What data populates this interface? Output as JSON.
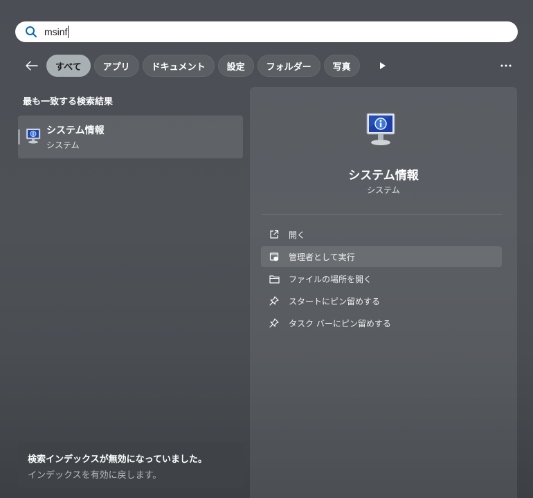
{
  "search": {
    "query": "msinf"
  },
  "filters": {
    "tabs": [
      {
        "label": "すべて",
        "active": true
      },
      {
        "label": "アプリ"
      },
      {
        "label": "ドキュメント"
      },
      {
        "label": "設定"
      },
      {
        "label": "フォルダー"
      },
      {
        "label": "写真"
      }
    ]
  },
  "results": {
    "section_title": "最も一致する検索結果",
    "best_match": {
      "name": "システム情報",
      "type": "システム",
      "icon": "system-info-monitor-icon"
    }
  },
  "detail": {
    "name": "システム情報",
    "type": "システム",
    "actions": [
      {
        "label": "開く",
        "icon": "open-external-icon"
      },
      {
        "label": "管理者として実行",
        "icon": "admin-shield-icon"
      },
      {
        "label": "ファイルの場所を開く",
        "icon": "folder-icon"
      },
      {
        "label": "スタートにピン留めする",
        "icon": "pin-icon"
      },
      {
        "label": "タスク バーにピン留めする",
        "icon": "pin-icon"
      }
    ]
  },
  "notice": {
    "title": "検索インデックスが無効になっていました。",
    "link": "インデックスを有効に戻します。"
  },
  "colors": {
    "accent": "#0067c0",
    "active_chip": "#a8b0b3"
  }
}
